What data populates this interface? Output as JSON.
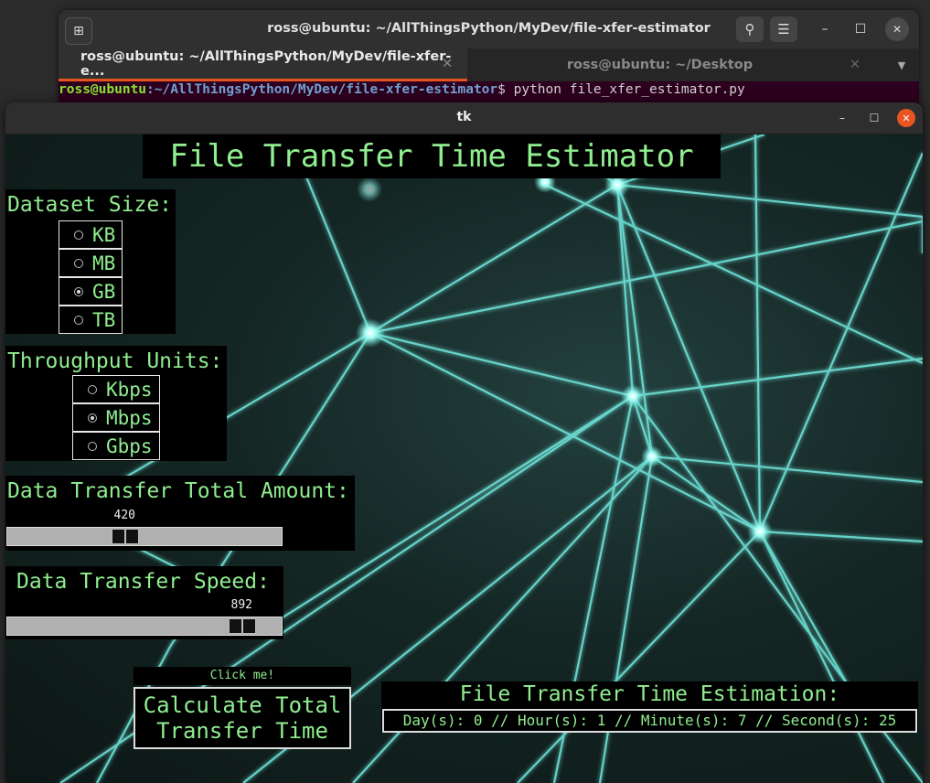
{
  "terminal": {
    "title": "ross@ubuntu: ~/AllThingsPython/MyDev/file-xfer-estimator",
    "tabs": [
      {
        "label": "ross@ubuntu: ~/AllThingsPython/MyDev/file-xfer-e...",
        "active": true
      },
      {
        "label": "ross@ubuntu: ~/Desktop",
        "active": false
      }
    ],
    "prompt_user": "ross@ubuntu",
    "prompt_path": ":~/AllThingsPython/MyDev/file-xfer-estimator",
    "prompt_symbol": "$",
    "command": " python file_xfer_estimator.py",
    "icons": [
      "new-tab-icon",
      "search-icon",
      "menu-icon",
      "minimize-icon",
      "maximize-icon",
      "close-icon"
    ]
  },
  "window": {
    "title": "tk",
    "close_color": "#e95420"
  },
  "app": {
    "title": "File Transfer Time Estimator",
    "accent_color": "#90ee90",
    "dataset": {
      "label": "Dataset Size:",
      "options": [
        "KB",
        "MB",
        "GB",
        "TB"
      ],
      "selected": "GB"
    },
    "throughput": {
      "label": "Throughput Units:",
      "options": [
        "Kbps",
        "Mbps",
        "Gbps"
      ],
      "selected": "Mbps"
    },
    "amount": {
      "label": "Data Transfer Total Amount:",
      "value": "420",
      "fraction": 0.42
    },
    "speed": {
      "label": "Data Transfer Speed:",
      "value": "892",
      "fraction": 0.892
    },
    "calc": {
      "hint": "Click me!",
      "line1": "Calculate Total",
      "line2": "Transfer Time"
    },
    "result": {
      "title": "File Transfer Time Estimation:",
      "value": "Day(s): 0 // Hour(s): 1 // Minute(s): 7 // Second(s): 25"
    }
  }
}
